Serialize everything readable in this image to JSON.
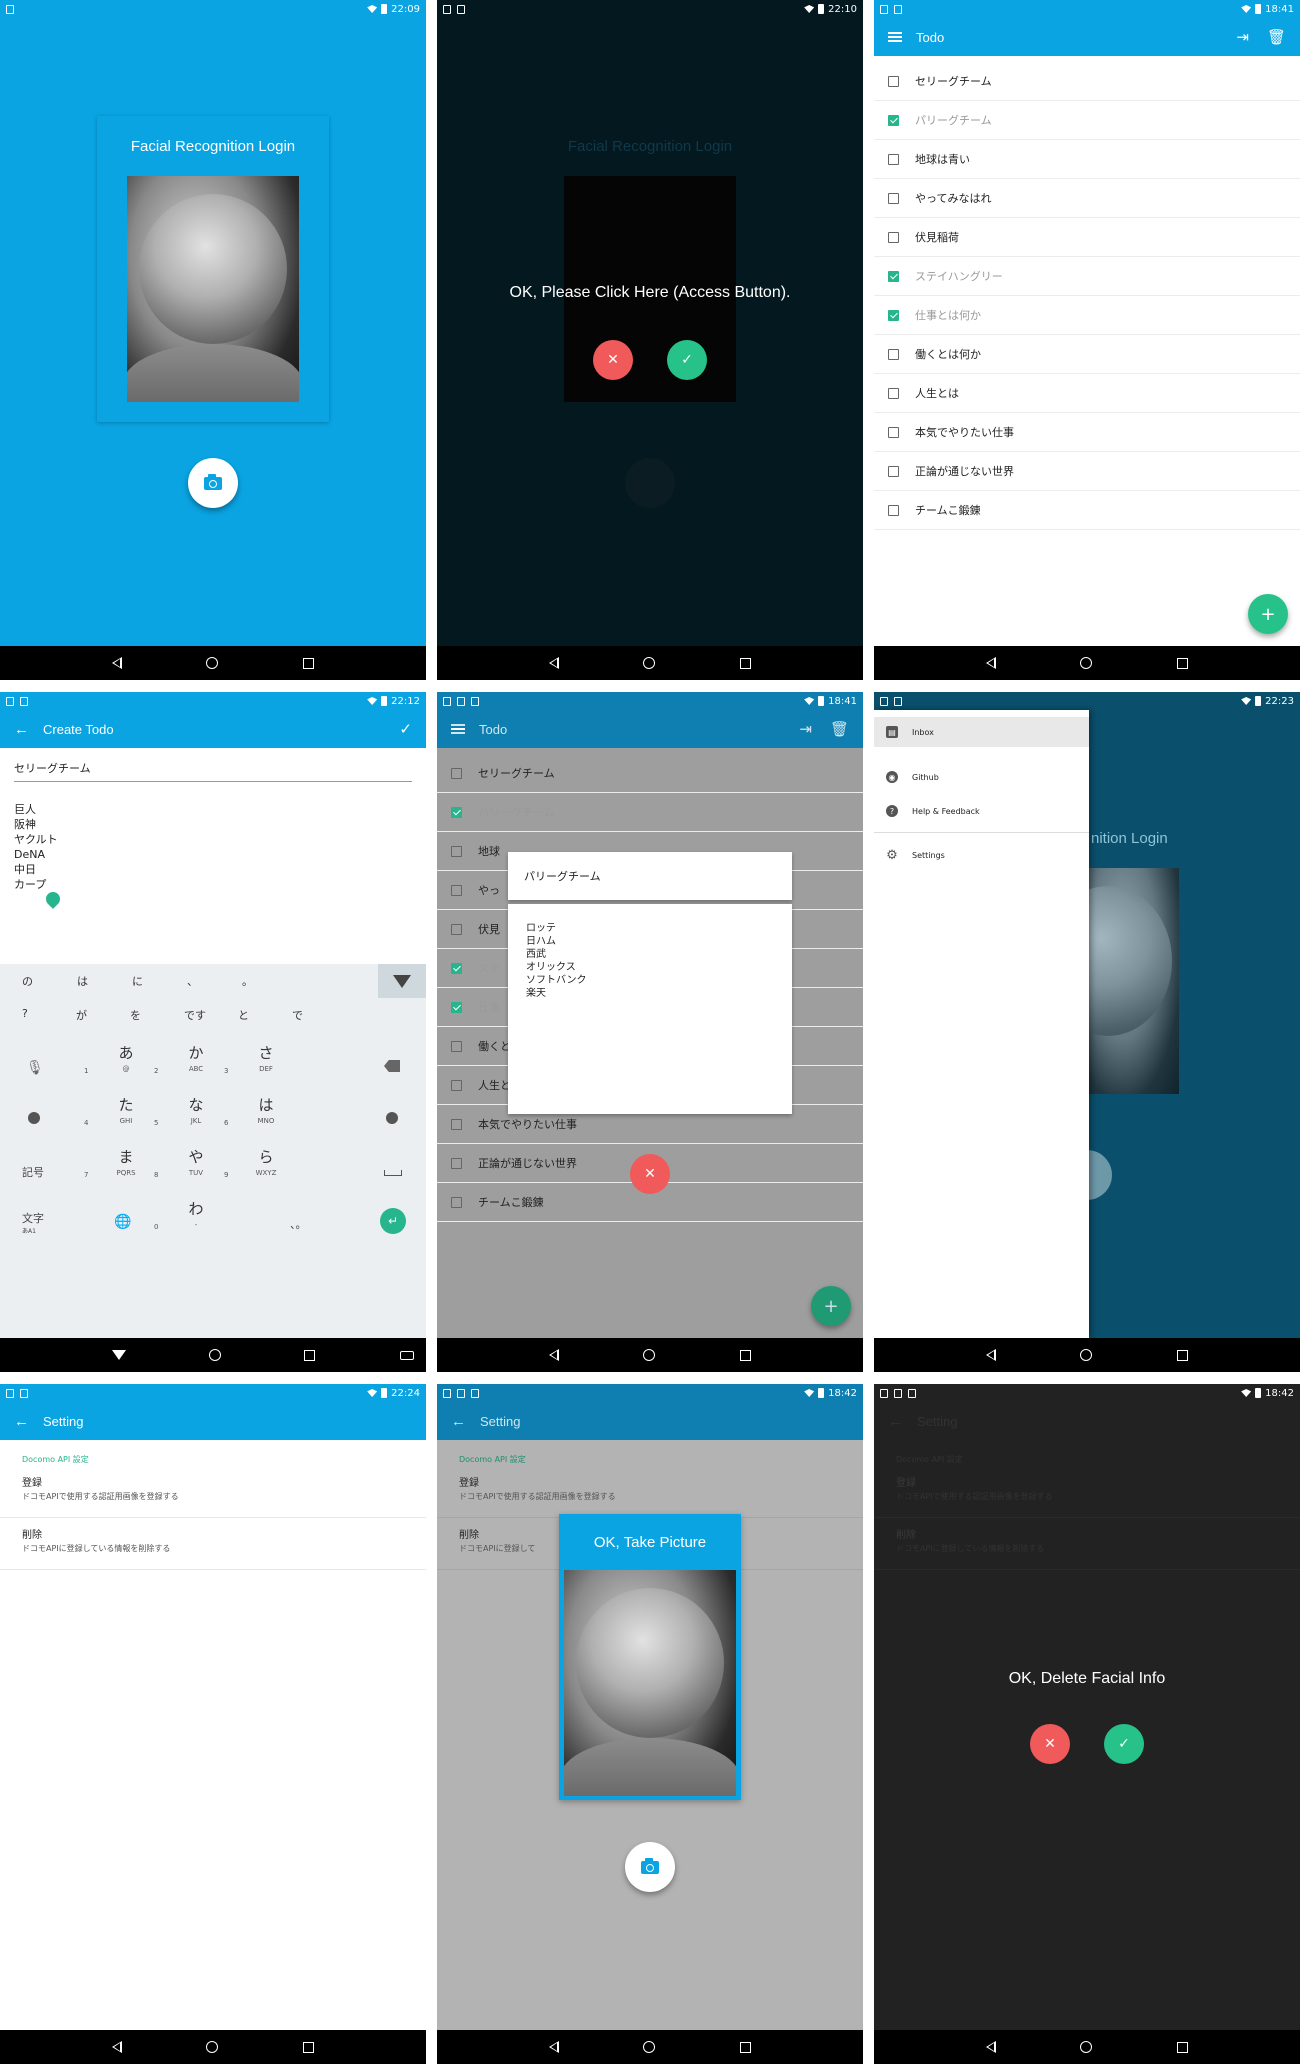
{
  "colors": {
    "primary": "#0aa4e3",
    "primary_dark_dim": "#0e7fb0",
    "accent_green": "#26b58c",
    "red": "#f05a5a",
    "dialog_bg_dark": "#03181f",
    "gray_dim": "#9e9e9e",
    "black": "#000000"
  },
  "screen1": {
    "status_time": "22:09",
    "card_title": "Facial Recognition Login"
  },
  "screen2": {
    "status_time": "22:10",
    "card_title": "Facial Recognition Login",
    "prompt": "OK, Please Click Here (Access Button).",
    "cancel_icon": "close-icon",
    "confirm_icon": "check-icon"
  },
  "screen3": {
    "status_time": "18:41",
    "title": "Todo",
    "todos": [
      {
        "label": "セリーグチーム",
        "done": false
      },
      {
        "label": "パリーグチーム",
        "done": true
      },
      {
        "label": "地球は青い",
        "done": false
      },
      {
        "label": "やってみなはれ",
        "done": false
      },
      {
        "label": "伏見稲荷",
        "done": false
      },
      {
        "label": "ステイハングリー",
        "done": true
      },
      {
        "label": "仕事とは何か",
        "done": true
      },
      {
        "label": "働くとは何か",
        "done": false
      },
      {
        "label": "人生とは",
        "done": false
      },
      {
        "label": "本気でやりたい仕事",
        "done": false
      },
      {
        "label": "正論が通じない世界",
        "done": false
      },
      {
        "label": "チームこ鍛錬",
        "done": false
      }
    ],
    "fab_label": "+"
  },
  "screen4": {
    "status_time": "22:12",
    "title": "Create Todo",
    "field_title": "セリーグチーム",
    "body_lines": [
      "巨人",
      "阪神",
      "ヤクルト",
      "DeNA",
      "中日",
      "カープ"
    ],
    "suggestions_row1": [
      "の",
      "は",
      "に",
      "、",
      "。"
    ],
    "suggestions_row2": [
      "?",
      "が",
      "を",
      "です",
      "と",
      "で"
    ],
    "keys": [
      {
        "main": "あ",
        "sub": "@",
        "num": "1"
      },
      {
        "main": "か",
        "sub": "ABC",
        "num": "2"
      },
      {
        "main": "さ",
        "sub": "DEF",
        "num": "3"
      },
      {
        "main": "た",
        "sub": "GHI",
        "num": "4"
      },
      {
        "main": "な",
        "sub": "JKL",
        "num": "5"
      },
      {
        "main": "は",
        "sub": "MNO",
        "num": "6"
      },
      {
        "main": "ま",
        "sub": "PQRS",
        "num": "7"
      },
      {
        "main": "や",
        "sub": "TUV",
        "num": "8"
      },
      {
        "main": "ら",
        "sub": "WXYZ",
        "num": "9"
      },
      {
        "main": "わ",
        "sub": "-",
        "num": "0"
      }
    ],
    "key_kigou": "記号",
    "key_moji": "文字",
    "key_moji_sub": "あA1",
    "key_punct": "、。"
  },
  "screen5": {
    "status_time": "18:41",
    "title": "Todo",
    "todos": [
      {
        "label": "セリーグチーム",
        "done": false
      },
      {
        "label": "パリーグチーム",
        "done": true
      },
      {
        "label": "地球",
        "done": false
      },
      {
        "label": "やっ",
        "done": false
      },
      {
        "label": "伏見",
        "done": false
      },
      {
        "label": "ステ",
        "done": true
      },
      {
        "label": "仕事",
        "done": true
      },
      {
        "label": "働くとは何か",
        "done": false
      },
      {
        "label": "人生とは",
        "done": false
      },
      {
        "label": "本気でやりたい仕事",
        "done": false
      },
      {
        "label": "正論が通じない世界",
        "done": false
      },
      {
        "label": "チームこ鍛錬",
        "done": false
      }
    ],
    "dialog_title": "パリーグチーム",
    "dialog_lines": [
      "ロッテ",
      "日ハム",
      "西武",
      "オリックス",
      "ソフトバンク",
      "楽天"
    ],
    "fab_label": "+"
  },
  "screen6": {
    "status_time": "22:23",
    "bg_title": "nition Login",
    "drawer_items": [
      {
        "label": "Inbox",
        "icon": "inbox-icon"
      },
      {
        "label": "Github",
        "icon": "github-icon"
      },
      {
        "label": "Help & Feedback",
        "icon": "help-icon"
      },
      {
        "label": "Settings",
        "icon": "gear-icon"
      }
    ]
  },
  "screen7": {
    "status_time": "22:24",
    "title": "Setting",
    "section": "Docomo API 設定",
    "items": [
      {
        "title": "登録",
        "desc": "ドコモAPIで使用する認証用画像を登録する"
      },
      {
        "title": "削除",
        "desc": "ドコモAPIに登録している情報を削除する"
      }
    ]
  },
  "screen8": {
    "status_time": "18:42",
    "title": "Setting",
    "section": "Docomo API 設定",
    "items": [
      {
        "title": "登録",
        "desc": "ドコモAPIで使用する認証用画像を登録する"
      },
      {
        "title": "削除",
        "desc": "ドコモAPIに登録して"
      }
    ],
    "dialog_title": "OK, Take Picture"
  },
  "screen9": {
    "status_time": "18:42",
    "title": "Setting",
    "section": "Docomo API 設定",
    "items": [
      {
        "title": "登録",
        "desc": "ドコモAPIで使用する認証用画像を登録する"
      },
      {
        "title": "削除",
        "desc": "ドコモAPIに登録している情報を削除する"
      }
    ],
    "prompt": "OK, Delete Facial Info"
  }
}
